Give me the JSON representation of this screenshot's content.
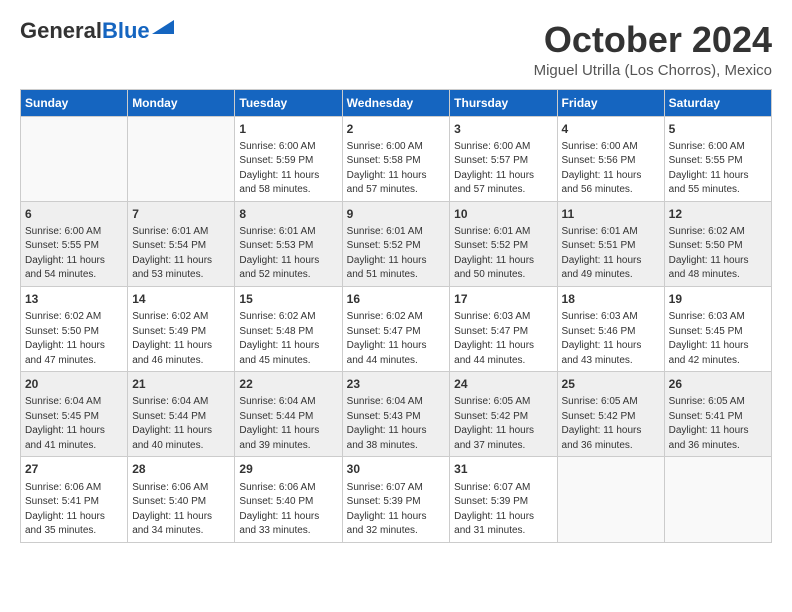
{
  "header": {
    "logo_line1": "General",
    "logo_line2": "Blue",
    "month": "October 2024",
    "location": "Miguel Utrilla (Los Chorros), Mexico"
  },
  "weekdays": [
    "Sunday",
    "Monday",
    "Tuesday",
    "Wednesday",
    "Thursday",
    "Friday",
    "Saturday"
  ],
  "weeks": [
    [
      {
        "day": "",
        "info": ""
      },
      {
        "day": "",
        "info": ""
      },
      {
        "day": "1",
        "info": "Sunrise: 6:00 AM\nSunset: 5:59 PM\nDaylight: 11 hours and 58 minutes."
      },
      {
        "day": "2",
        "info": "Sunrise: 6:00 AM\nSunset: 5:58 PM\nDaylight: 11 hours and 57 minutes."
      },
      {
        "day": "3",
        "info": "Sunrise: 6:00 AM\nSunset: 5:57 PM\nDaylight: 11 hours and 57 minutes."
      },
      {
        "day": "4",
        "info": "Sunrise: 6:00 AM\nSunset: 5:56 PM\nDaylight: 11 hours and 56 minutes."
      },
      {
        "day": "5",
        "info": "Sunrise: 6:00 AM\nSunset: 5:55 PM\nDaylight: 11 hours and 55 minutes."
      }
    ],
    [
      {
        "day": "6",
        "info": "Sunrise: 6:00 AM\nSunset: 5:55 PM\nDaylight: 11 hours and 54 minutes."
      },
      {
        "day": "7",
        "info": "Sunrise: 6:01 AM\nSunset: 5:54 PM\nDaylight: 11 hours and 53 minutes."
      },
      {
        "day": "8",
        "info": "Sunrise: 6:01 AM\nSunset: 5:53 PM\nDaylight: 11 hours and 52 minutes."
      },
      {
        "day": "9",
        "info": "Sunrise: 6:01 AM\nSunset: 5:52 PM\nDaylight: 11 hours and 51 minutes."
      },
      {
        "day": "10",
        "info": "Sunrise: 6:01 AM\nSunset: 5:52 PM\nDaylight: 11 hours and 50 minutes."
      },
      {
        "day": "11",
        "info": "Sunrise: 6:01 AM\nSunset: 5:51 PM\nDaylight: 11 hours and 49 minutes."
      },
      {
        "day": "12",
        "info": "Sunrise: 6:02 AM\nSunset: 5:50 PM\nDaylight: 11 hours and 48 minutes."
      }
    ],
    [
      {
        "day": "13",
        "info": "Sunrise: 6:02 AM\nSunset: 5:50 PM\nDaylight: 11 hours and 47 minutes."
      },
      {
        "day": "14",
        "info": "Sunrise: 6:02 AM\nSunset: 5:49 PM\nDaylight: 11 hours and 46 minutes."
      },
      {
        "day": "15",
        "info": "Sunrise: 6:02 AM\nSunset: 5:48 PM\nDaylight: 11 hours and 45 minutes."
      },
      {
        "day": "16",
        "info": "Sunrise: 6:02 AM\nSunset: 5:47 PM\nDaylight: 11 hours and 44 minutes."
      },
      {
        "day": "17",
        "info": "Sunrise: 6:03 AM\nSunset: 5:47 PM\nDaylight: 11 hours and 44 minutes."
      },
      {
        "day": "18",
        "info": "Sunrise: 6:03 AM\nSunset: 5:46 PM\nDaylight: 11 hours and 43 minutes."
      },
      {
        "day": "19",
        "info": "Sunrise: 6:03 AM\nSunset: 5:45 PM\nDaylight: 11 hours and 42 minutes."
      }
    ],
    [
      {
        "day": "20",
        "info": "Sunrise: 6:04 AM\nSunset: 5:45 PM\nDaylight: 11 hours and 41 minutes."
      },
      {
        "day": "21",
        "info": "Sunrise: 6:04 AM\nSunset: 5:44 PM\nDaylight: 11 hours and 40 minutes."
      },
      {
        "day": "22",
        "info": "Sunrise: 6:04 AM\nSunset: 5:44 PM\nDaylight: 11 hours and 39 minutes."
      },
      {
        "day": "23",
        "info": "Sunrise: 6:04 AM\nSunset: 5:43 PM\nDaylight: 11 hours and 38 minutes."
      },
      {
        "day": "24",
        "info": "Sunrise: 6:05 AM\nSunset: 5:42 PM\nDaylight: 11 hours and 37 minutes."
      },
      {
        "day": "25",
        "info": "Sunrise: 6:05 AM\nSunset: 5:42 PM\nDaylight: 11 hours and 36 minutes."
      },
      {
        "day": "26",
        "info": "Sunrise: 6:05 AM\nSunset: 5:41 PM\nDaylight: 11 hours and 36 minutes."
      }
    ],
    [
      {
        "day": "27",
        "info": "Sunrise: 6:06 AM\nSunset: 5:41 PM\nDaylight: 11 hours and 35 minutes."
      },
      {
        "day": "28",
        "info": "Sunrise: 6:06 AM\nSunset: 5:40 PM\nDaylight: 11 hours and 34 minutes."
      },
      {
        "day": "29",
        "info": "Sunrise: 6:06 AM\nSunset: 5:40 PM\nDaylight: 11 hours and 33 minutes."
      },
      {
        "day": "30",
        "info": "Sunrise: 6:07 AM\nSunset: 5:39 PM\nDaylight: 11 hours and 32 minutes."
      },
      {
        "day": "31",
        "info": "Sunrise: 6:07 AM\nSunset: 5:39 PM\nDaylight: 11 hours and 31 minutes."
      },
      {
        "day": "",
        "info": ""
      },
      {
        "day": "",
        "info": ""
      }
    ]
  ]
}
